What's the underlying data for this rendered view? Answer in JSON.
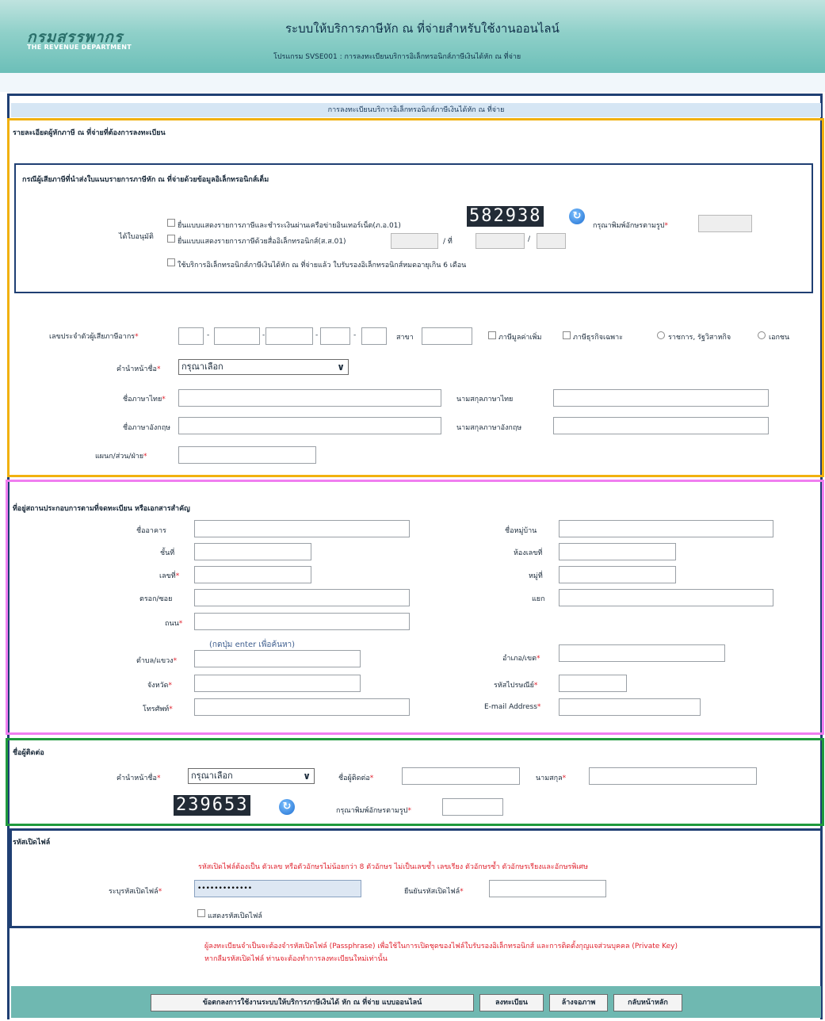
{
  "header": {
    "logo_th": "กรมสรรพากร",
    "logo_en": "THE REVENUE DEPARTMENT",
    "title": "ระบบให้บริการภาษีหัก ณ ที่จ่ายสำหรับใช้งานออนไลน์",
    "program": "โปรแกรม SVSE001 : การลงทะเบียนบริการอิเล็กทรอนิกส์ภาษีเงินได้หัก ณ ที่จ่าย"
  },
  "page_title": "การลงทะเบียนบริการอิเล็กทรอนิกส์ภาษีเงินได้หัก ณ ที่จ่าย",
  "taxpayer": {
    "section_title": "รายละเอียดผู้หักภาษี ณ ที่จ่ายที่ต้องการลงทะเบียน",
    "ecert_title": "กรณีผู้เสียภาษีที่นำส่งใบแนบรายการภาษีหัก ณ ที่จ่ายด้วยข้อมูลอิเล็กทรอนิกส์เต็ม",
    "license_label": "ได้ใบอนุมัติ",
    "option1": "ยื่นแบบแสดงรายการภาษีและชำระเงินผ่านเครือข่ายอินเทอร์เน็ต(ภ.อ.01)",
    "option2": "ยื่นแบบแสดงรายการภาษีด้วยสื่ออิเล็กทรอนิกส์(ส.ส.01)",
    "option3": "ใช้บริการอิเล็กทรอนิกส์ภาษีเงินได้หัก ณ ที่จ่ายแล้ว ใบรับรองอิเล็กทรอนิกส์หมดอายุเกิน 6 เดือน",
    "sep_no": "/ ที่",
    "sep_slash": "/",
    "captcha1": "582938",
    "captcha_prompt": "กรุณาพิมพ์อักษรตามรูป",
    "tin_label": "เลขประจำตัวผู้เสียภาษีอากร",
    "dash": "-",
    "branch_label": "สาขา",
    "vat_label": "ภาษีมูลค่าเพิ่ม",
    "sbt_label": "ภาษีธุรกิจเฉพาะ",
    "gov_label": "ราชการ, รัฐวิสาหกิจ",
    "private_label": "เอกชน",
    "prefix_label": "คำนำหน้าชื่อ",
    "prefix_value": "กรุณาเลือก",
    "name_th_label": "ชื่อภาษาไทย",
    "surname_th_label": "นามสกุลภาษาไทย",
    "name_en_label": "ชื่อภาษาอังกฤษ",
    "surname_en_label": "นามสกุลภาษาอังกฤษ",
    "dept_label": "แผนก/ส่วน/ฝ่าย"
  },
  "address": {
    "section_title": "ที่อยู่สถานประกอบการตามที่จดทะเบียน หรือเอกสารสำคัญ",
    "building": "ชื่ออาคาร",
    "village": "ชื่อหมู่บ้าน",
    "floor": "ชั้นที่",
    "room": "ห้องเลขที่",
    "number": "เลขที่",
    "moo": "หมู่ที่",
    "alley": "ตรอก/ซอย",
    "junction": "แยก",
    "road": "ถนน",
    "hint": "(กดปุ่ม enter เพื่อค้นหา)",
    "subdistrict": "ตำบล/แขวง",
    "district": "อำเภอ/เขต",
    "province": "จังหวัด",
    "postcode": "รหัสไปรษณีย์",
    "phone": "โทรศัพท์",
    "email": "E-mail Address"
  },
  "contact": {
    "section_title": "ชื่อผู้ติดต่อ",
    "prefix_label": "คำนำหน้าชื่อ",
    "prefix_value": "กรุณาเลือก",
    "name_label": "ชื่อผู้ติดต่อ",
    "surname_label": "นามสกุล",
    "captcha2": "239653",
    "captcha_prompt": "กรุณาพิมพ์อักษรตามรูป"
  },
  "password": {
    "section_title": "รหัสเปิดไฟล์",
    "rule": "รหัสเปิดไฟล์ต้องเป็น ตัวเลข หรือตัวอักษรไม่น้อยกว่า 8 ตัวอักษร ไม่เป็นเลขซ้ำ เลขเรียง ตัวอักษรซ้ำ ตัวอักษรเรียงและอักษรพิเศษ",
    "enter_label": "ระบุรหัสเปิดไฟล์",
    "enter_value": "•••••••••••••",
    "confirm_label": "ยืนยันรหัสเปิดไฟล์",
    "show_label": "แสดงรหัสเปิดไฟล์"
  },
  "notice": {
    "line1": "ผู้ลงทะเบียนจำเป็นจะต้องจำรหัสเปิดไฟล์ (Passphrase) เพื่อใช้ในการเปิดชุดของไฟล์ใบรับรองอิเล็กทรอนิกส์ และการติดตั้งกุญแจส่วนบุคคล (Private Key)",
    "line2": "หากลืมรหัสเปิดไฟล์ ท่านจะต้องทำการลงทะเบียนใหม่เท่านั้น"
  },
  "buttons": {
    "terms": "ข้อตกลงการใช้งานระบบให้บริการภาษีเงินได้ หัก ณ ที่จ่าย แบบออนไลน์",
    "register": "ลงทะเบียน",
    "clear": "ล้างจอภาพ",
    "home": "กลับหน้าหลัก"
  },
  "colors": {
    "header_teal": "#8fd0c9",
    "border_navy": "#1f3f73",
    "border_orange": "#f1b10f",
    "border_pink": "#f07ef0",
    "border_green": "#1f9a3d",
    "required_red": "#e0202c"
  }
}
